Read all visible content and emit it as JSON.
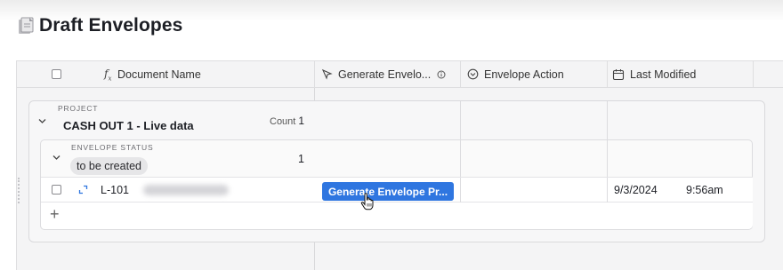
{
  "page": {
    "title": "Draft Envelopes",
    "title_icon": "document-page-icon"
  },
  "columns": [
    {
      "label": "Document Name",
      "icon": "formula-icon"
    },
    {
      "label": "Generate Envelo...",
      "icon": "cursor-click-icon",
      "extra_icon": "info-icon"
    },
    {
      "label": "Envelope Action",
      "icon": "chevron-circle-icon"
    },
    {
      "label": "Last Modified",
      "icon": "calendar-edit-icon"
    }
  ],
  "group_project": {
    "caption": "PROJECT",
    "name": "CASH OUT 1 - Live data",
    "count_label": "Count",
    "count": "1"
  },
  "group_status": {
    "caption": "ENVELOPE STATUS",
    "name": "to be created",
    "count": "1"
  },
  "rows": [
    {
      "document_name": "L-101",
      "generate_button": "Generate Envelope Pr...",
      "last_modified_date": "9/3/2024",
      "last_modified_time": "9:56am"
    }
  ],
  "add_row_label": "+",
  "colors": {
    "button_blue": "#2f76e0",
    "grid_bg": "#f4f4f5",
    "border": "#dedee0"
  }
}
